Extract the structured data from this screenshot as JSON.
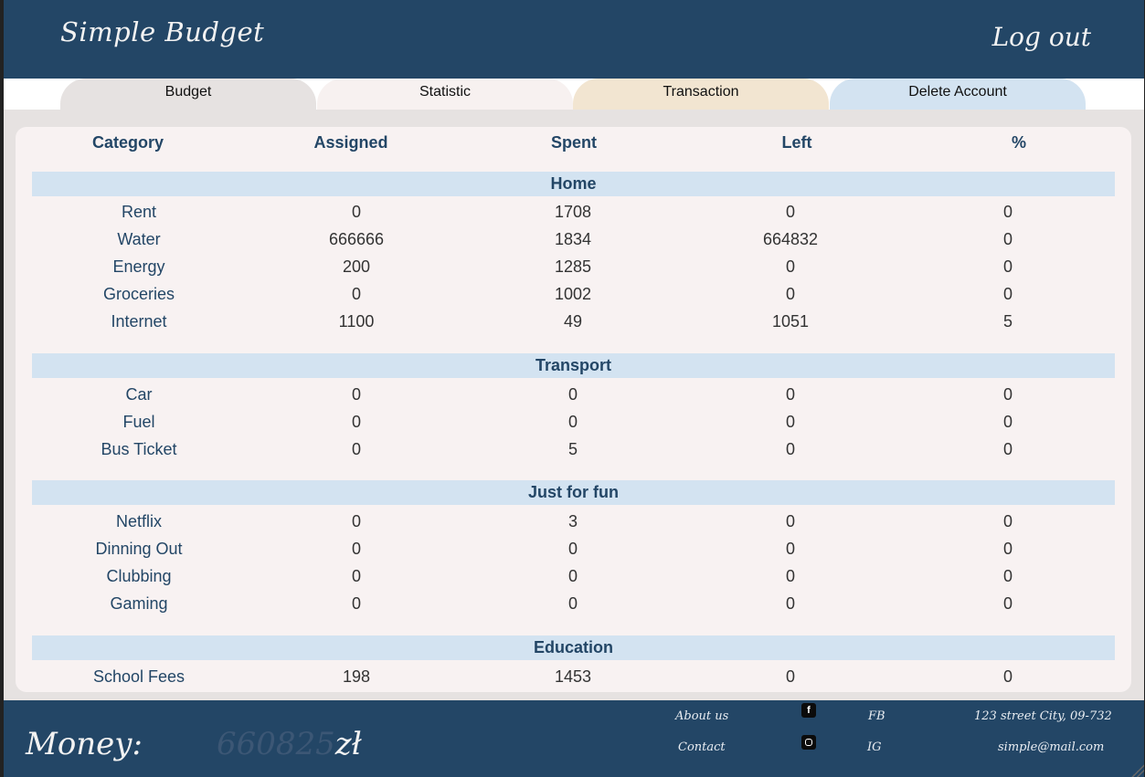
{
  "header": {
    "title": "Simple Budget",
    "logout": "Log out"
  },
  "tabs": [
    "Budget",
    "Statistic",
    "Transaction",
    "Delete Account"
  ],
  "table": {
    "columns": [
      "Category",
      "Assigned",
      "Spent",
      "Left",
      "%"
    ],
    "sections": [
      {
        "name": "Home",
        "rows": [
          [
            "Rent",
            "0",
            "1708",
            "0",
            "0"
          ],
          [
            "Water",
            "666666",
            "1834",
            "664832",
            "0"
          ],
          [
            "Energy",
            "200",
            "1285",
            "0",
            "0"
          ],
          [
            "Groceries",
            "0",
            "1002",
            "0",
            "0"
          ],
          [
            "Internet",
            "1100",
            "49",
            "1051",
            "5"
          ]
        ]
      },
      {
        "name": "Transport",
        "rows": [
          [
            "Car",
            "0",
            "0",
            "0",
            "0"
          ],
          [
            "Fuel",
            "0",
            "0",
            "0",
            "0"
          ],
          [
            "Bus Ticket",
            "0",
            "5",
            "0",
            "0"
          ]
        ]
      },
      {
        "name": "Just for fun",
        "rows": [
          [
            "Netflix",
            "0",
            "3",
            "0",
            "0"
          ],
          [
            "Dinning Out",
            "0",
            "0",
            "0",
            "0"
          ],
          [
            "Clubbing",
            "0",
            "0",
            "0",
            "0"
          ],
          [
            "Gaming",
            "0",
            "0",
            "0",
            "0"
          ]
        ]
      },
      {
        "name": "Education",
        "rows": [
          [
            "School Fees",
            "198",
            "1453",
            "0",
            "0"
          ]
        ]
      }
    ]
  },
  "footer": {
    "money_label": "Money:",
    "money_value": "660825",
    "currency": "zł",
    "about": "About us",
    "contact": "Contact",
    "fb_icon": "facebook-icon",
    "ig_icon": "instagram-icon",
    "fb": "FB",
    "ig": "IG",
    "address": "123 street City, 09-732",
    "email": "simple@mail.com"
  },
  "colors": {
    "header_bg": "#234666",
    "section_bg": "#d3e3f1",
    "panel_bg": "#f8f2f2",
    "text": "#234666"
  }
}
